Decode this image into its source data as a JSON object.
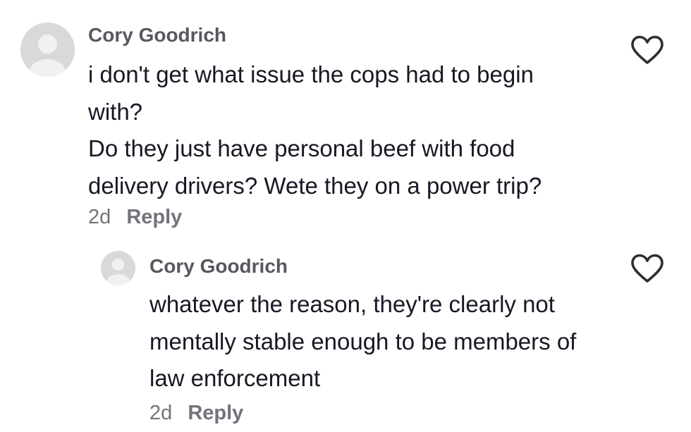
{
  "comment": {
    "username": "Cory Goodrich",
    "lines": [
      "i don't get what issue the cops had to begin",
      "with?",
      "Do they just have personal beef with food",
      "delivery drivers? Wete they on a power trip?"
    ],
    "time": "2d",
    "reply_label": "Reply",
    "like_icon": "heart-outline-icon"
  },
  "reply": {
    "username": "Cory Goodrich",
    "lines": [
      "whatever the reason, they're clearly not",
      "mentally stable enough to be members of",
      "law enforcement"
    ],
    "time": "2d",
    "reply_label": "Reply",
    "like_icon": "heart-outline-icon"
  },
  "colors": {
    "username": "#57585f",
    "text": "#161823",
    "meta": "#73747b",
    "avatar_bg": "#d9d9d9",
    "icon": "#2f2f33"
  }
}
